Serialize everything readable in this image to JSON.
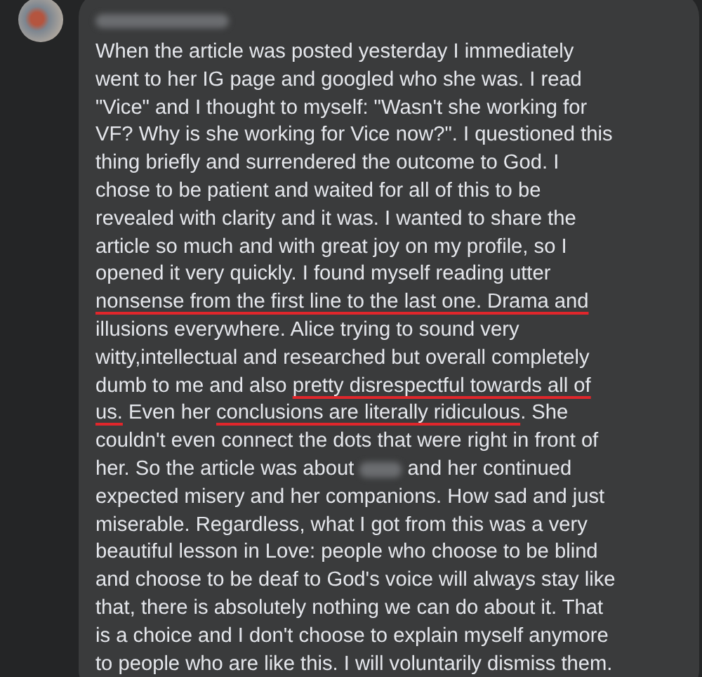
{
  "comment": {
    "author": {
      "redacted": true
    },
    "lines": [
      [
        {
          "text": "When the article was posted yesterday I immediately"
        }
      ],
      [
        {
          "text": "went to her IG page and googled who she was. I read"
        }
      ],
      [
        {
          "text": "\"Vice\" and I thought to myself: \"Wasn't she working for"
        }
      ],
      [
        {
          "text": "VF? Why is she working for Vice now?\". I questioned this"
        }
      ],
      [
        {
          "text": "thing briefly and surrendered the outcome to God. I"
        }
      ],
      [
        {
          "text": "chose to be patient and waited for all of this to be"
        }
      ],
      [
        {
          "text": "revealed with clarity and it was. I wanted to share the"
        }
      ],
      [
        {
          "text": "article so much and with great joy on my profile, so I"
        }
      ],
      [
        {
          "text": "opened it very quickly. I found myself reading utter"
        }
      ],
      [
        {
          "text": "nonsense from the first line to the last one. Drama and",
          "underlined": true
        }
      ],
      [
        {
          "text": "illusions everywhere. Alice trying to sound very"
        }
      ],
      [
        {
          "text": "witty,intellectual and researched but overall completely"
        }
      ],
      [
        {
          "text": "dumb to me and also "
        },
        {
          "text": "pretty disrespectful towards all of",
          "underlined": true
        }
      ],
      [
        {
          "text": "us.",
          "underlined": true
        },
        {
          "text": " Even her "
        },
        {
          "text": "conclusions are literally ridiculous",
          "underlined": true
        },
        {
          "text": ". She"
        }
      ],
      [
        {
          "text": "couldn't even connect the dots that were right in front of"
        }
      ],
      [
        {
          "text": "her. So the article was about "
        },
        {
          "kind": "redacted"
        },
        {
          "text": " and her continued"
        }
      ],
      [
        {
          "text": "expected misery and her companions. How sad and just"
        }
      ],
      [
        {
          "text": "miserable. Regardless, what I got from this was a very"
        }
      ],
      [
        {
          "text": "beautiful lesson in Love: people who choose to be blind"
        }
      ],
      [
        {
          "text": "and choose to be deaf to God's voice will always stay like"
        }
      ],
      [
        {
          "text": "that, there is absolutely nothing we can do about it. That"
        }
      ],
      [
        {
          "text": "is a choice and I don't choose to explain myself anymore"
        }
      ],
      [
        {
          "text": "to people who are like this. I will voluntarily dismiss them."
        }
      ]
    ]
  }
}
